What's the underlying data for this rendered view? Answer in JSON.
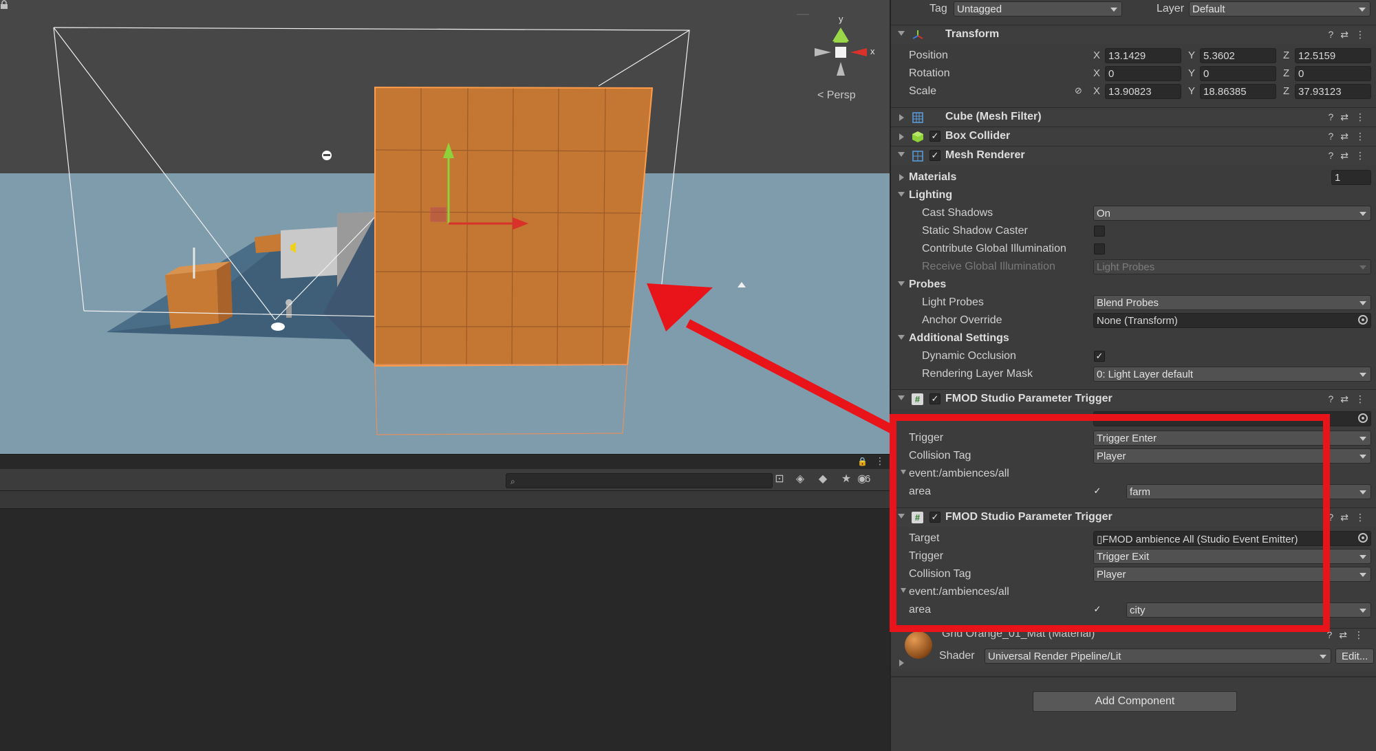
{
  "scene": {
    "persp_label": "< Persp",
    "gizmo_y": "y",
    "gizmo_x": "x"
  },
  "lower_left": {
    "search_placeholder": "",
    "hidden_count": "6"
  },
  "inspector": {
    "tag_label": "Tag",
    "tag_value": "Untagged",
    "layer_label": "Layer",
    "layer_value": "Default",
    "transform": {
      "title": "Transform",
      "position_label": "Position",
      "rotation_label": "Rotation",
      "scale_label": "Scale",
      "position": {
        "x": "13.1429",
        "y": "5.3602",
        "z": "12.5159"
      },
      "rotation": {
        "x": "0",
        "y": "0",
        "z": "0"
      },
      "scale": {
        "x": "13.90823",
        "y": "18.86385",
        "z": "37.93123"
      }
    },
    "mesh_filter_title": "Cube (Mesh Filter)",
    "box_collider_title": "Box Collider",
    "mesh_renderer": {
      "title": "Mesh Renderer",
      "materials_label": "Materials",
      "materials_count": "1",
      "lighting_label": "Lighting",
      "cast_shadows_label": "Cast Shadows",
      "cast_shadows_value": "On",
      "static_shadow_label": "Static Shadow Caster",
      "contribute_gi_label": "Contribute Global Illumination",
      "receive_gi_label": "Receive Global Illumination",
      "receive_gi_value": "Light Probes",
      "probes_label": "Probes",
      "light_probes_label": "Light Probes",
      "light_probes_value": "Blend Probes",
      "anchor_override_label": "Anchor Override",
      "anchor_override_value": "None (Transform)",
      "additional_label": "Additional Settings",
      "dynamic_occlusion_label": "Dynamic Occlusion",
      "rendering_layer_label": "Rendering Layer Mask",
      "rendering_layer_value": "0: Light Layer default"
    },
    "fmod1": {
      "title": "FMOD Studio Parameter Trigger",
      "trigger_label": "Trigger",
      "trigger_value": "Trigger Enter",
      "collision_tag_label": "Collision Tag",
      "collision_tag_value": "Player",
      "event_label": "event:/ambiences/all",
      "area_label": "area",
      "area_value": "farm"
    },
    "fmod2": {
      "title": "FMOD Studio Parameter Trigger",
      "target_label": "Target",
      "target_value": "FMOD ambience All (Studio Event Emitter)",
      "trigger_label": "Trigger",
      "trigger_value": "Trigger Exit",
      "collision_tag_label": "Collision Tag",
      "collision_tag_value": "Player",
      "event_label": "event:/ambiences/all",
      "area_label": "area",
      "area_value": "city"
    },
    "material": {
      "title": "Grid Orange_01_Mat (Material)",
      "shader_label": "Shader",
      "shader_value": "Universal Render Pipeline/Lit",
      "edit_label": "Edit..."
    },
    "add_component_label": "Add Component"
  },
  "colors": {
    "annotation": "#e8141a",
    "cube": "#c77a34",
    "ground": "#7d9bac"
  }
}
